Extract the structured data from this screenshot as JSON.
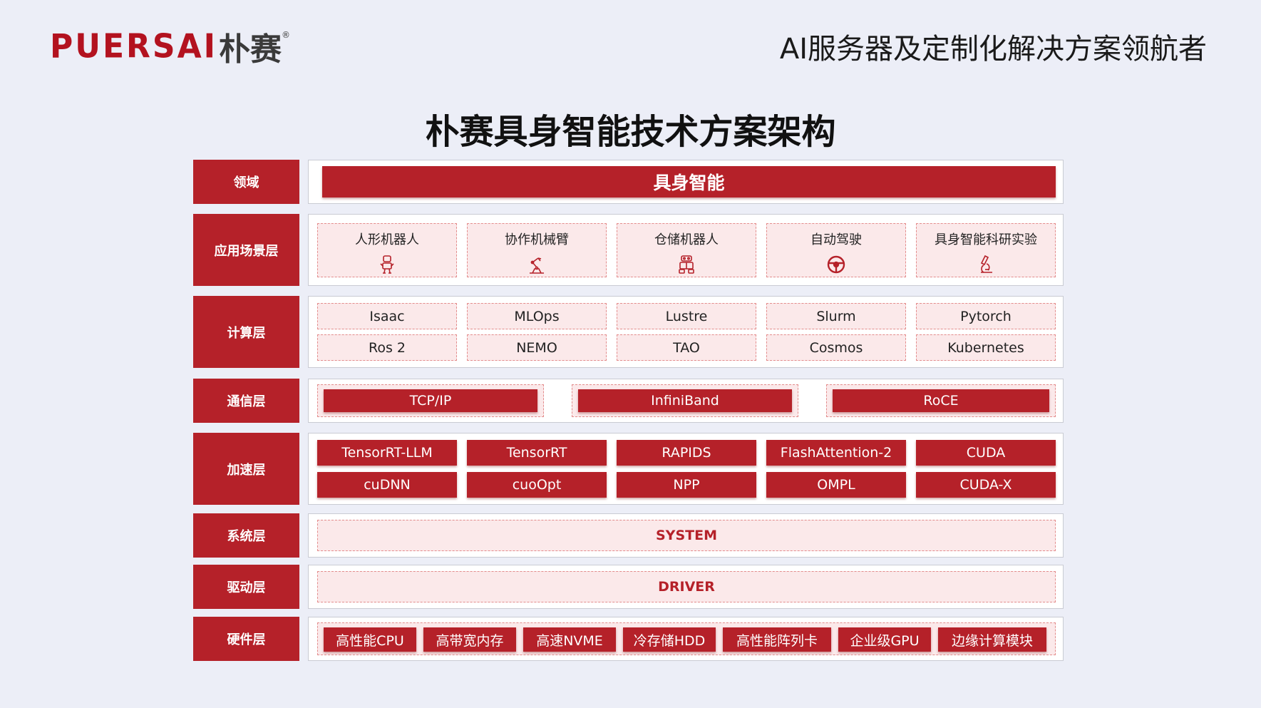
{
  "brand": {
    "logo_latin": "PUERSAI",
    "logo_cn": "朴赛",
    "registered": "®"
  },
  "slogan": "AI服务器及定制化解决方案领航者",
  "title": "朴赛具身智能技术方案架构",
  "layers": {
    "domain": {
      "label": "领域",
      "value": "具身智能"
    },
    "application": {
      "label": "应用场景层",
      "items": [
        {
          "label": "人形机器人",
          "icon": "humanoid-robot-icon"
        },
        {
          "label": "协作机械臂",
          "icon": "robot-arm-icon"
        },
        {
          "label": "仓储机器人",
          "icon": "warehouse-robot-icon"
        },
        {
          "label": "自动驾驶",
          "icon": "steering-wheel-icon"
        },
        {
          "label": "具身智能科研实验",
          "icon": "microscope-icon"
        }
      ]
    },
    "compute": {
      "label": "计算层",
      "items": [
        "Isaac",
        "MLOps",
        "Lustre",
        "Slurm",
        "Pytorch",
        "Ros 2",
        "NEMO",
        "TAO",
        "Cosmos",
        "Kubernetes"
      ]
    },
    "network": {
      "label": "通信层",
      "items": [
        "TCP/IP",
        "InfiniBand",
        "RoCE"
      ]
    },
    "acceleration": {
      "label": "加速层",
      "items": [
        "TensorRT-LLM",
        "TensorRT",
        "RAPIDS",
        "FlashAttention-2",
        "CUDA",
        "cuDNN",
        "cuoOpt",
        "NPP",
        "OMPL",
        "CUDA-X"
      ]
    },
    "system": {
      "label": "系统层",
      "value": "SYSTEM"
    },
    "driver": {
      "label": "驱动层",
      "value": "DRIVER"
    },
    "hardware": {
      "label": "硬件层",
      "items": [
        "高性能CPU",
        "高带宽内存",
        "高速NVME",
        "冷存储HDD",
        "高性能阵列卡",
        "企业级GPU",
        "边缘计算模块"
      ]
    }
  },
  "colors": {
    "accent": "#b52129",
    "background": "#eceef7",
    "dash_fill": "#fbe9ea",
    "dash_border": "#e38c8c"
  }
}
